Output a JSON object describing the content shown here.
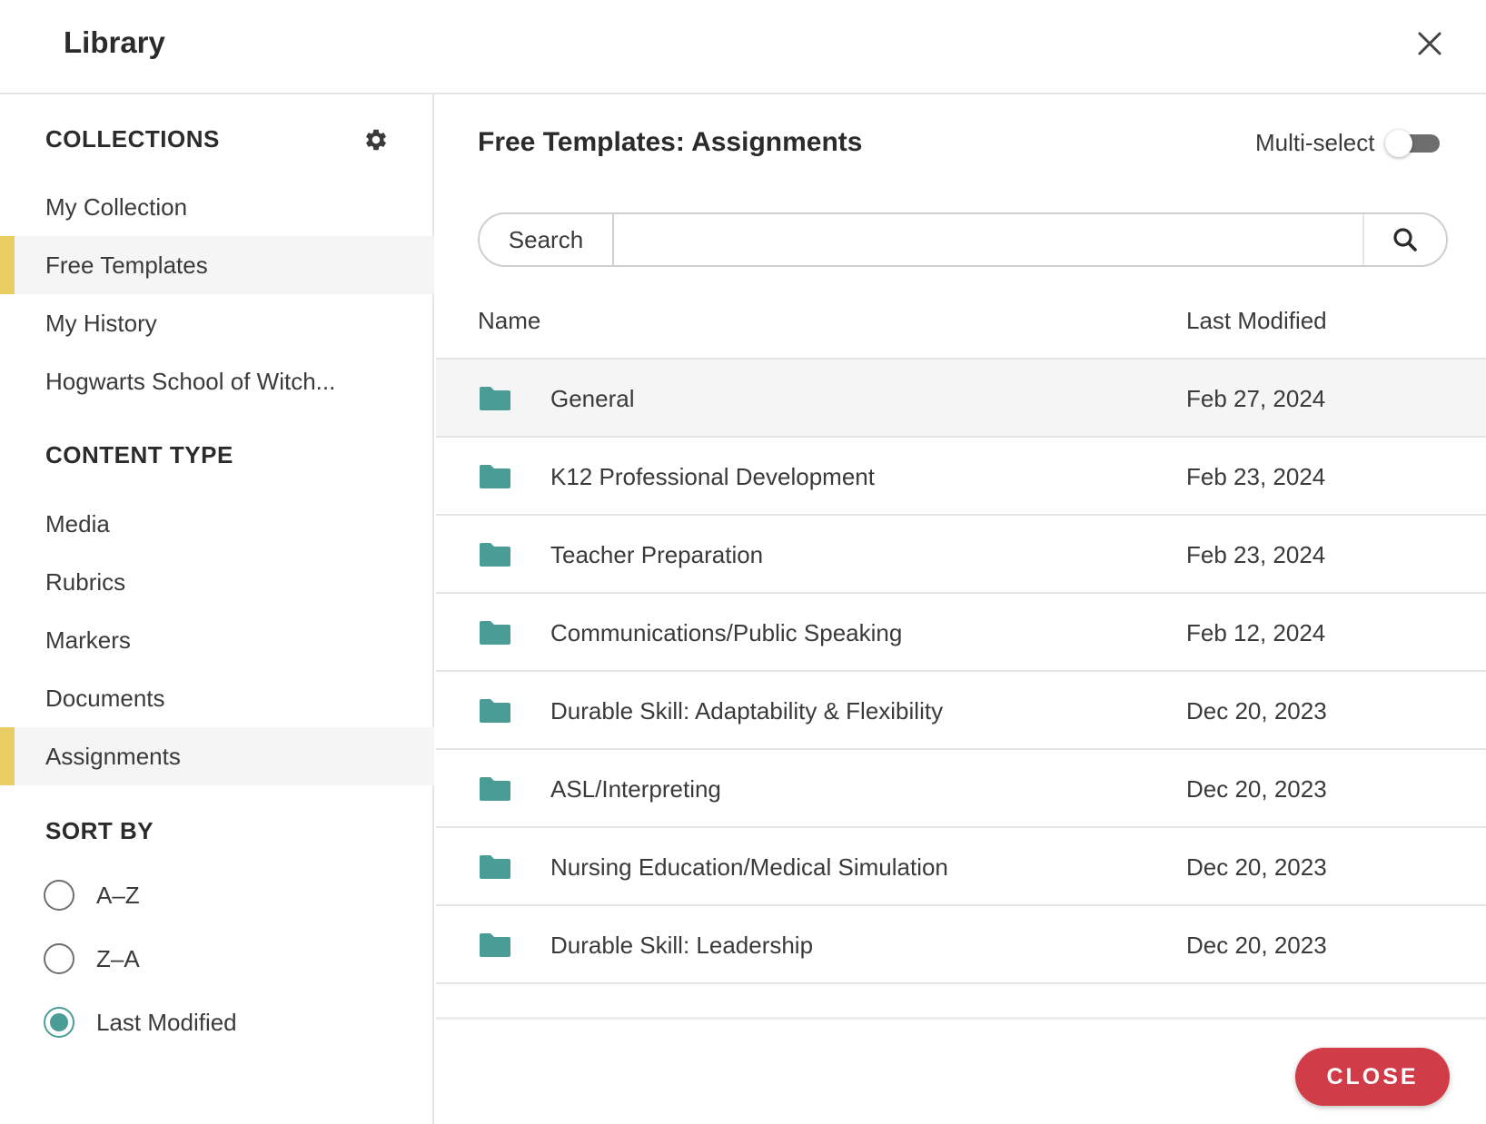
{
  "header": {
    "title": "Library",
    "close_icon": "close-icon"
  },
  "sidebar": {
    "collections_title": "COLLECTIONS",
    "collections": [
      {
        "label": "My Collection",
        "active": false
      },
      {
        "label": "Free Templates",
        "active": true
      },
      {
        "label": "My History",
        "active": false
      },
      {
        "label": "Hogwarts School of Witch...",
        "active": false
      }
    ],
    "content_type_title": "CONTENT TYPE",
    "content_types": [
      {
        "label": "Media",
        "active": false
      },
      {
        "label": "Rubrics",
        "active": false
      },
      {
        "label": "Markers",
        "active": false
      },
      {
        "label": "Documents",
        "active": false
      },
      {
        "label": "Assignments",
        "active": true
      }
    ],
    "sort_title": "SORT BY",
    "sort_options": [
      {
        "label": "A–Z",
        "checked": false
      },
      {
        "label": "Z–A",
        "checked": false
      },
      {
        "label": "Last Modified",
        "checked": true
      }
    ]
  },
  "main": {
    "heading": "Free Templates: Assignments",
    "multi_select_label": "Multi-select",
    "multi_select_on": false,
    "search": {
      "label": "Search",
      "value": "",
      "placeholder": ""
    },
    "columns": {
      "name": "Name",
      "modified": "Last Modified"
    },
    "rows": [
      {
        "name": "General",
        "date": "Feb 27, 2024",
        "highlighted": true
      },
      {
        "name": "K12 Professional Development",
        "date": "Feb 23, 2024",
        "highlighted": false
      },
      {
        "name": "Teacher Preparation",
        "date": "Feb 23, 2024",
        "highlighted": false
      },
      {
        "name": "Communications/Public Speaking",
        "date": "Feb 12, 2024",
        "highlighted": false
      },
      {
        "name": "Durable Skill: Adaptability & Flexibility",
        "date": "Dec 20, 2023",
        "highlighted": false
      },
      {
        "name": "ASL/Interpreting",
        "date": "Dec 20, 2023",
        "highlighted": false
      },
      {
        "name": "Nursing Education/Medical Simulation",
        "date": "Dec 20, 2023",
        "highlighted": false
      },
      {
        "name": "Durable Skill: Leadership",
        "date": "Dec 20, 2023",
        "highlighted": false
      }
    ],
    "close_button": "CLOSE"
  },
  "colors": {
    "accent_teal": "#4a9d96",
    "active_marker": "#e8ce62",
    "close_red": "#d03c48",
    "toggle_off": "#6e6e6e"
  },
  "icons": {
    "header_close": "close-icon",
    "collections_settings": "gear-icon",
    "search": "search-icon",
    "row": "folder-icon"
  }
}
